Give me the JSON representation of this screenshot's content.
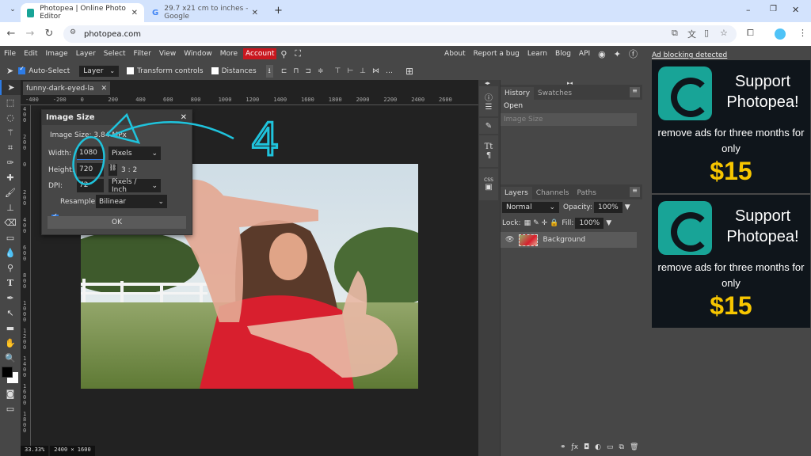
{
  "browser": {
    "tabs": [
      {
        "title": "Photopea | Online Photo Editor",
        "active": true,
        "favicon_color": "#18a497"
      },
      {
        "title": "29.7 x21 cm to inches - Google",
        "active": false,
        "favicon_color": "#4285f4"
      }
    ],
    "url": "photopea.com",
    "window_controls": [
      "minimize",
      "restore",
      "close"
    ]
  },
  "menu": {
    "items": [
      "File",
      "Edit",
      "Image",
      "Layer",
      "Select",
      "Filter",
      "View",
      "Window",
      "More"
    ],
    "account": "Account",
    "right_links": [
      "About",
      "Report a bug",
      "Learn",
      "Blog",
      "API"
    ]
  },
  "options": {
    "auto_select_label": "Auto-Select",
    "auto_select_checked": true,
    "layer_select": "Layer",
    "transform_label": "Transform controls",
    "distances_label": "Distances"
  },
  "document": {
    "tab_title": "funny-dark-eyed-la",
    "h_ruler_ticks": [
      "-400",
      "-200",
      "0",
      "200",
      "400",
      "600",
      "800",
      "1000",
      "1200",
      "1400",
      "1600",
      "1800",
      "2000",
      "2200",
      "2400",
      "2600"
    ],
    "v_ruler_ticks": [
      "400",
      "200",
      "0",
      "200",
      "400",
      "600",
      "800",
      "1000",
      "1200",
      "1400",
      "1600",
      "1800"
    ],
    "zoom": "33.33%",
    "dimensions": "2400 × 1600"
  },
  "dialog": {
    "title": "Image Size",
    "image_size_text": "Image Size: 3.84 MPx",
    "width_label": "Width:",
    "width_value": "1080",
    "width_unit": "Pixels",
    "height_label": "Height:",
    "height_value": "720",
    "ratio": "3 : 2",
    "dpi_label": "DPI:",
    "dpi_value": "72",
    "dpi_unit": "Pixels / Inch",
    "resample_label": "Resample",
    "resample_checked": true,
    "resample_method": "Bilinear",
    "ok_label": "OK"
  },
  "annotation": {
    "text": "4",
    "color": "#1fc3dc"
  },
  "history_panel": {
    "tabs": [
      "History",
      "Swatches"
    ],
    "entries": [
      "Open",
      "Image Size"
    ]
  },
  "layers_panel": {
    "tabs": [
      "Layers",
      "Channels",
      "Paths"
    ],
    "blend_mode": "Normal",
    "opacity_label": "Opacity:",
    "opacity": "100%",
    "lock_label": "Lock:",
    "fill_label": "Fill:",
    "fill": "100%",
    "layers": [
      {
        "name": "Background",
        "visible": true
      }
    ]
  },
  "ads": {
    "notice": "Ad blocking detected",
    "banners": [
      {
        "headline": "Support Photopea!",
        "body": "remove ads for three months for only",
        "price": "$15"
      },
      {
        "headline": "Support Photopea!",
        "body": "remove ads for three months for only",
        "price": "$15"
      }
    ]
  }
}
